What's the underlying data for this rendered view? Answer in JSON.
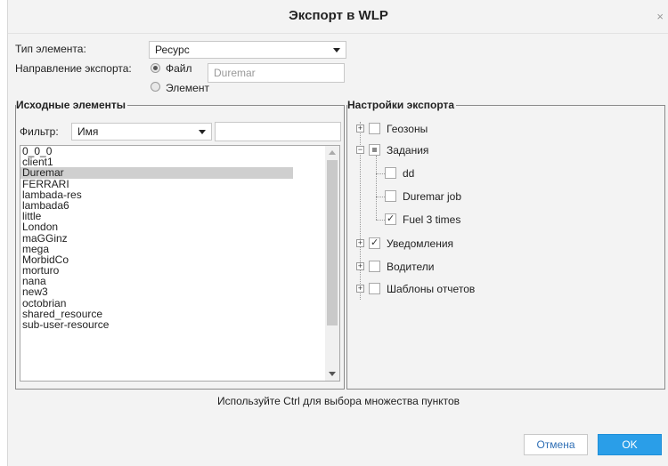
{
  "window": {
    "title": "Экспорт в WLP",
    "close_glyph": "×"
  },
  "element_type": {
    "label": "Тип элемента:",
    "value": "Ресурс"
  },
  "direction": {
    "label": "Направление экспорта:",
    "options": [
      {
        "label": "Файл",
        "selected": true
      },
      {
        "label": "Элемент",
        "selected": false
      }
    ],
    "file_name": "Duremar"
  },
  "source": {
    "legend": "Исходные элементы",
    "filter_label": "Фильтр:",
    "filter_field": "Имя",
    "filter_text": "",
    "items": [
      "0_0_0",
      "client1",
      "Duremar",
      "FERRARI",
      "lambada-res",
      "lambada6",
      "little",
      "London",
      "maGGinz",
      "mega",
      "MorbidCo",
      "morturo",
      "nana",
      "new3",
      "octobrian",
      "shared_resource",
      "sub-user-resource"
    ],
    "selected_item": "Duremar"
  },
  "settings": {
    "legend": "Настройки экспорта",
    "tree": [
      {
        "label": "Геозоны",
        "state": "unchecked",
        "expander": "+"
      },
      {
        "label": "Задания",
        "state": "partial",
        "expander": "−",
        "children": [
          {
            "label": "dd",
            "state": "unchecked"
          },
          {
            "label": "Duremar job",
            "state": "unchecked"
          },
          {
            "label": "Fuel 3 times",
            "state": "checked"
          }
        ]
      },
      {
        "label": "Уведомления",
        "state": "checked",
        "expander": "+"
      },
      {
        "label": "Водители",
        "state": "unchecked",
        "expander": "+"
      },
      {
        "label": "Шаблоны отчетов",
        "state": "unchecked",
        "expander": "+"
      }
    ]
  },
  "hint": "Используйте Ctrl для выбора множества пунктов",
  "buttons": {
    "cancel": "Отмена",
    "ok": "OK"
  }
}
